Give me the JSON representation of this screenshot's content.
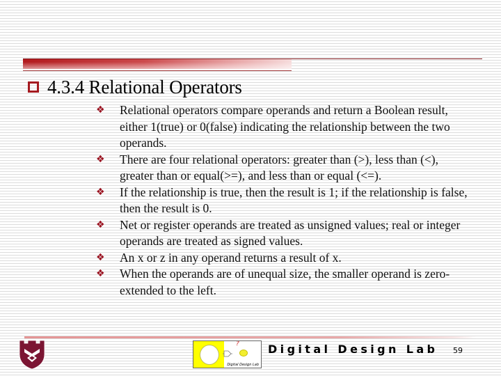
{
  "slide": {
    "title": "4.3.4 Relational Operators",
    "title_bullet_icon": "hollow-square-icon",
    "bullet_icon": "four-diamond-icon",
    "bullet_glyph": "❖",
    "bullets": [
      "Relational operators compare operands and return a Boolean result, either 1(true) or 0(false) indicating the relationship between the two operands.",
      "There are four relational operators: greater than (>), less than (<), greater than or equal(>=), and less than or equal (<=).",
      "If the relationship is true, then the result is 1; if the relationship is false, then the result is 0.",
      "Net or register operands are treated as unsigned values; real or integer operands are treated as signed values.",
      "An x or z in any operand returns a result of x.",
      "When the operands are of unequal size, the smaller operand is zero-extended to the left."
    ]
  },
  "footer": {
    "shield_logo": "university-shield-icon",
    "lab_logo": {
      "question_mark": "?",
      "caption": "Digital Design Lab"
    },
    "lab_name": "Digital Design Lab",
    "page_number": "59"
  },
  "colors": {
    "accent_red": "#a51a20",
    "bullet_red": "#9a1220",
    "shield_maroon": "#7b1533",
    "logo_yellow": "#ffff00"
  }
}
